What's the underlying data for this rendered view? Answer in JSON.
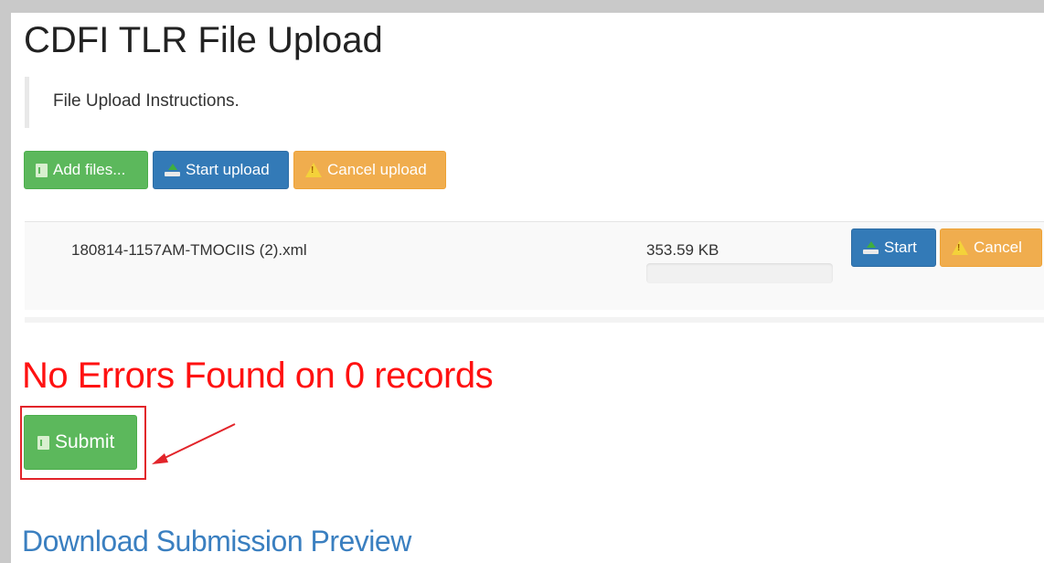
{
  "page": {
    "title": "CDFI TLR File Upload",
    "instructions": "File Upload Instructions."
  },
  "toolbar": {
    "add_files_label": "Add files...",
    "start_upload_label": "Start upload",
    "cancel_upload_label": "Cancel upload"
  },
  "file": {
    "name": "180814-1157AM-TMOCIIS (2).xml",
    "size": "353.59 KB",
    "progress": 0,
    "start_label": "Start",
    "cancel_label": "Cancel"
  },
  "result": {
    "status_text": "No Errors Found on 0 records",
    "submit_label": "Submit",
    "download_link": "Download Submission Preview"
  },
  "colors": {
    "green": "#5cb85c",
    "blue": "#337ab7",
    "orange": "#f0ad4e",
    "error_red": "#ff1111",
    "link_blue": "#3a7fc0",
    "annotation_red": "#e2242a"
  }
}
